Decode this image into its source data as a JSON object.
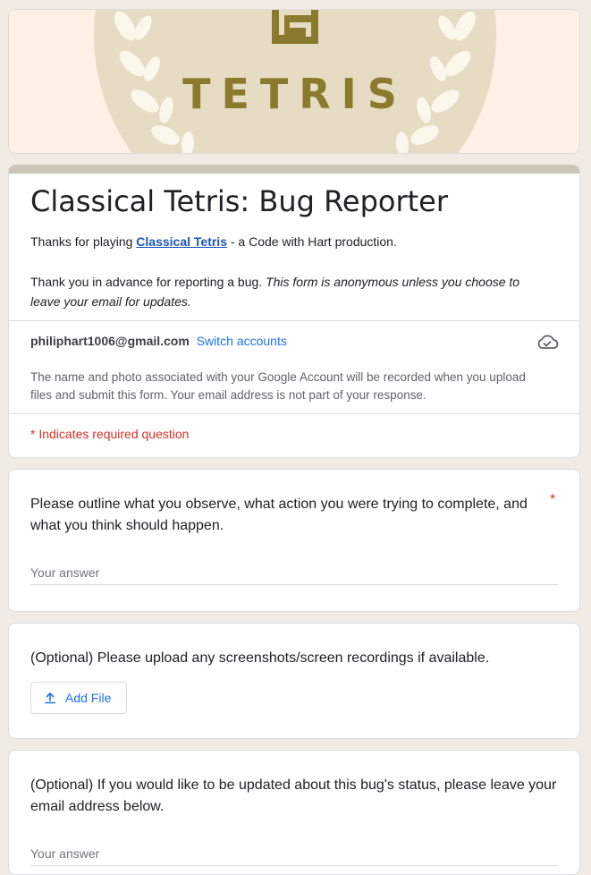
{
  "banner": {
    "logo_text": "TETRIS"
  },
  "form": {
    "title": "Classical Tetris: Bug Reporter",
    "desc_prefix": "Thanks for playing ",
    "desc_link": "Classical Tetris",
    "desc_suffix": " - a Code with Hart production.",
    "desc2_plain": "Thank you in advance for reporting a bug. ",
    "desc2_italic": "This form is anonymous unless you choose to leave your email for updates."
  },
  "account": {
    "email": "philiphart1006@gmail.com",
    "switch_label": "Switch accounts",
    "cloud_icon": "cloud-saved-icon",
    "privacy_note": "The name and photo associated with your Google Account will be recorded when you upload files and submit this form. Your email address is not part of your response."
  },
  "required_note": "* Indicates required question",
  "questions": [
    {
      "text": "Please outline what you observe, what action you were trying to complete, and what you think should happen.",
      "required_mark": "*",
      "placeholder": "Your answer"
    },
    {
      "text": "(Optional) Please upload any screenshots/screen recordings if available.",
      "button_label": "Add File",
      "button_icon": "upload-icon"
    },
    {
      "text": "(Optional) If you would like to be updated about this bug's status, please leave your email address below.",
      "placeholder": "Your answer"
    }
  ],
  "colors": {
    "page_bg": "#f1ebe3",
    "banner_bg": "#fdf0e4",
    "accent_bar": "#cdc4b9",
    "logo_gold": "#8a7a2e",
    "link_blue": "#1a73e8",
    "required_red": "#d93025"
  }
}
